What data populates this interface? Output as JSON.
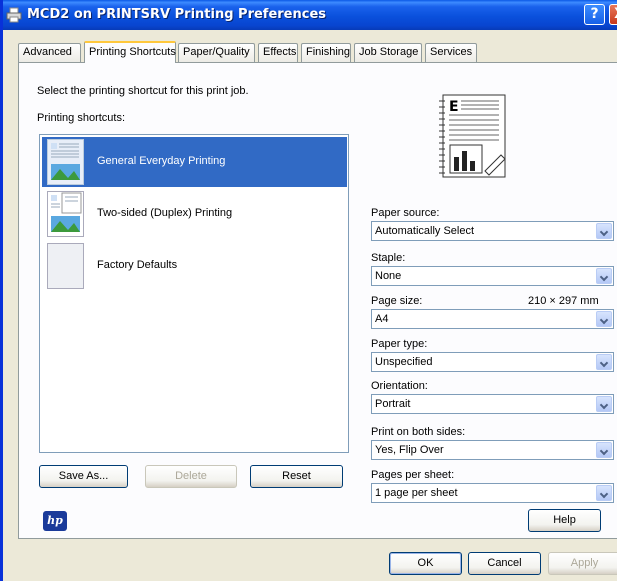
{
  "window": {
    "title": "MCD2 on PRINTSRV Printing Preferences",
    "help_button": "?",
    "close_button": "X"
  },
  "tabs": [
    {
      "label": "Advanced"
    },
    {
      "label": "Printing Shortcuts",
      "active": true
    },
    {
      "label": "Paper/Quality"
    },
    {
      "label": "Effects"
    },
    {
      "label": "Finishing"
    },
    {
      "label": "Job Storage"
    },
    {
      "label": "Services"
    }
  ],
  "shortcuts": {
    "instruction": "Select the printing shortcut for this print job.",
    "list_label": "Printing shortcuts:",
    "items": [
      {
        "label": "General Everyday Printing",
        "selected": true,
        "icon": "document-image-icon"
      },
      {
        "label": "Two-sided (Duplex) Printing",
        "selected": false,
        "icon": "duplex-document-icon"
      },
      {
        "label": "Factory Defaults",
        "selected": false,
        "icon": "blank-page-icon"
      }
    ],
    "save_as": "Save As...",
    "delete": "Delete",
    "reset": "Reset"
  },
  "settings": {
    "paper_source": {
      "label": "Paper source:",
      "value": "Automatically Select"
    },
    "staple": {
      "label": "Staple:",
      "value": "None"
    },
    "page_size": {
      "label": "Page size:",
      "value": "A4",
      "dimensions": "210 × 297 mm"
    },
    "paper_type": {
      "label": "Paper type:",
      "value": "Unspecified"
    },
    "orientation": {
      "label": "Orientation:",
      "value": "Portrait"
    },
    "print_both_sides": {
      "label": "Print on both sides:",
      "value": "Yes, Flip Over"
    },
    "pages_per_sheet": {
      "label": "Pages per sheet:",
      "value": "1 page per sheet"
    }
  },
  "help_button": "Help",
  "logo": "hp",
  "footer": {
    "ok": "OK",
    "cancel": "Cancel",
    "apply": "Apply"
  },
  "colors": {
    "selection": "#316ac5",
    "titlebar": "#0a50dc",
    "face": "#ece9d8"
  }
}
